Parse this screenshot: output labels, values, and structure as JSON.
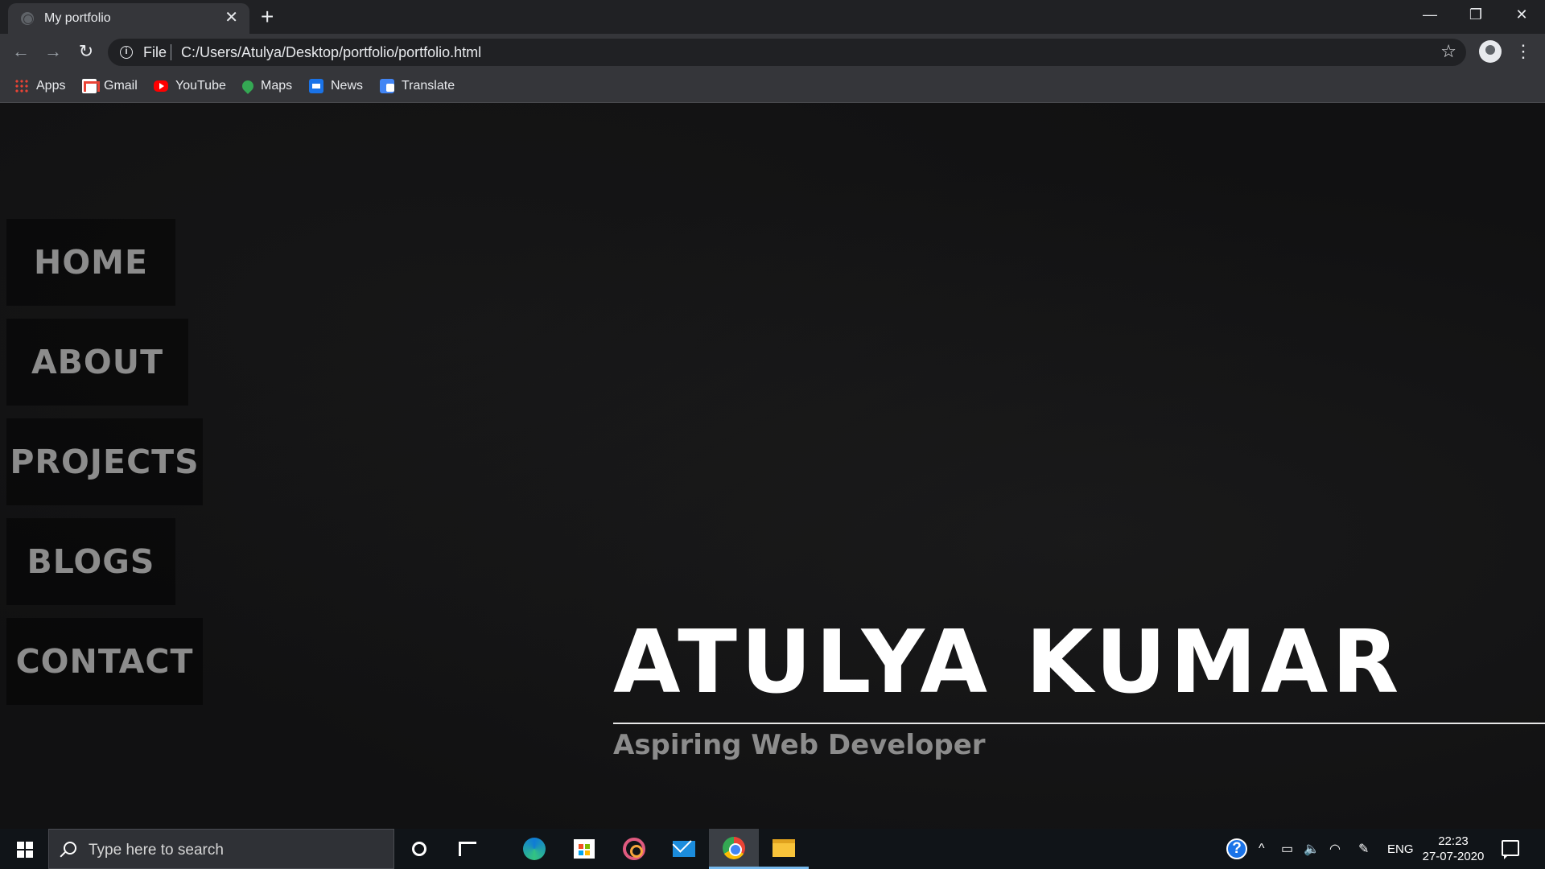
{
  "browser": {
    "tab_title": "My portfolio",
    "tab_close": "✕",
    "new_tab": "+",
    "window_controls": {
      "minimize": "—",
      "restore": "❐",
      "close": "✕"
    },
    "nav": {
      "back": "←",
      "forward": "→",
      "reload": "↻"
    },
    "address": {
      "info": "i",
      "scheme": "File",
      "url": "C:/Users/Atulya/Desktop/portfolio/portfolio.html",
      "star": "☆"
    },
    "menu": "⋮",
    "bookmarks": [
      {
        "label": "Apps",
        "icon": "apps-grid-icon"
      },
      {
        "label": "Gmail",
        "icon": "gmail-icon"
      },
      {
        "label": "YouTube",
        "icon": "youtube-icon"
      },
      {
        "label": "Maps",
        "icon": "maps-icon"
      },
      {
        "label": "News",
        "icon": "news-icon"
      },
      {
        "label": "Translate",
        "icon": "translate-icon"
      }
    ]
  },
  "page": {
    "nav_items": [
      "HOME",
      "ABOUT",
      "PROJECTS",
      "BLOGS",
      "CONTACT"
    ],
    "hero_name": "ATULYA KUMAR",
    "hero_subtitle": "Aspiring Web Developer",
    "colors": {
      "background": "#111112",
      "name": "#ffffff",
      "muted": "#8c8c8c"
    }
  },
  "taskbar": {
    "search_placeholder": "Type here to search",
    "tray": {
      "help": "?",
      "chevron": "^",
      "lang": "ENG",
      "battery": "▭",
      "volume": "🔈",
      "wifi": "◠",
      "pen": "✎"
    },
    "time": "22:23",
    "date": "27-07-2020",
    "pinned": [
      "cortana-icon",
      "task-view-icon",
      "edge-icon",
      "store-icon",
      "groove-icon",
      "mail-icon",
      "chrome-icon",
      "file-explorer-icon"
    ]
  }
}
